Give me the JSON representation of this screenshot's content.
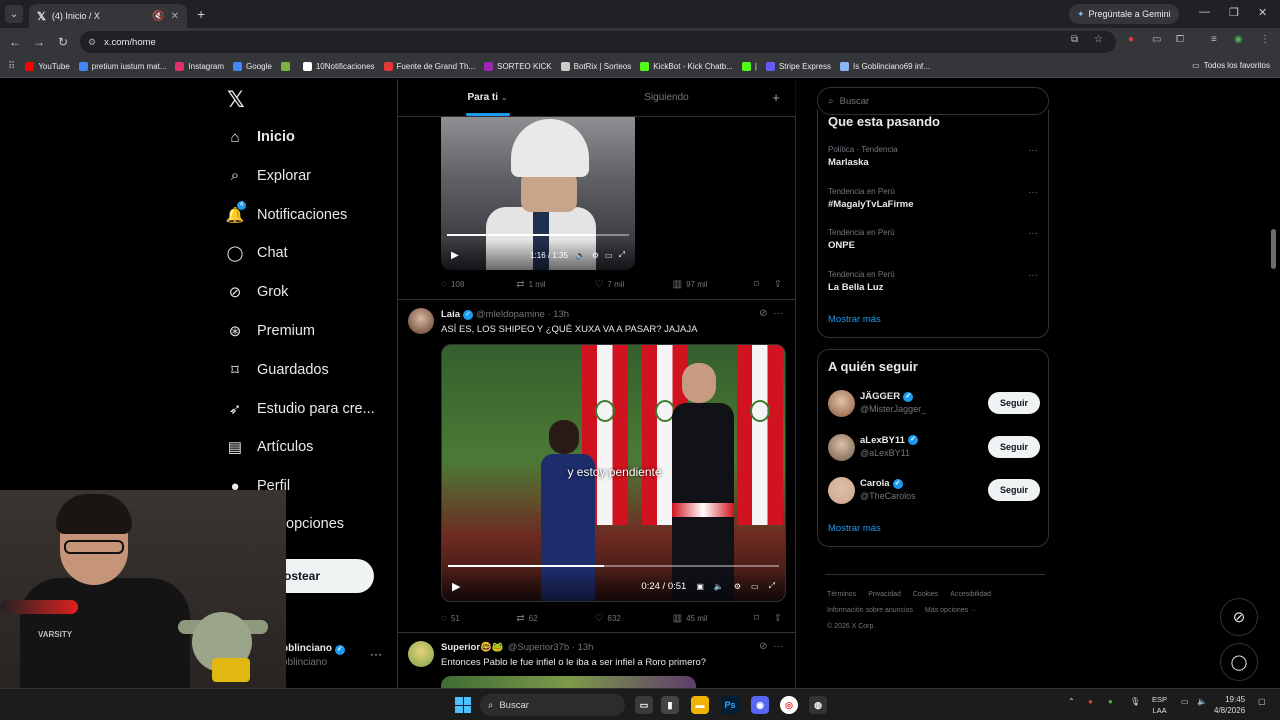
{
  "browser": {
    "tab_title": "(4) Inicio / X",
    "url": "x.com/home",
    "gemini_label": "Pregúntale a Gemini",
    "bookmarks": [
      {
        "label": "YouTube",
        "color": "#ff0000"
      },
      {
        "label": "pretium iustum mat...",
        "color": "#4285f4"
      },
      {
        "label": "Instagram",
        "color": "#e1306c"
      },
      {
        "label": "Google",
        "color": "#4285f4"
      },
      {
        "label": "",
        "color": "#7cb342"
      },
      {
        "label": "10Notificaciones",
        "color": "#ffffff"
      },
      {
        "label": "Fuente de Grand Th...",
        "color": "#e53935"
      },
      {
        "label": "SORTEO KICK",
        "color": "#9c27b0"
      },
      {
        "label": "BotRix | Sorteos",
        "color": "#cccccc"
      },
      {
        "label": "KickBot - Kick Chatb...",
        "color": "#53fc18"
      },
      {
        "label": "|",
        "color": "#53fc18"
      },
      {
        "label": "Stripe Express",
        "color": "#635bff"
      },
      {
        "label": "Is Goblinciano69 inf...",
        "color": "#8ab4f8"
      }
    ],
    "all_bookmarks": "Todos los favoritos"
  },
  "sidebar": {
    "items": [
      {
        "label": "Inicio",
        "icon": "home-icon"
      },
      {
        "label": "Explorar",
        "icon": "search-icon"
      },
      {
        "label": "Notificaciones",
        "icon": "bell-icon",
        "badge": "4"
      },
      {
        "label": "Chat",
        "icon": "chat-icon"
      },
      {
        "label": "Grok",
        "icon": "grok-icon"
      },
      {
        "label": "Premium",
        "icon": "premium-icon"
      },
      {
        "label": "Guardados",
        "icon": "bookmark-icon"
      },
      {
        "label": "Estudio para cre...",
        "icon": "rocket-icon"
      },
      {
        "label": "Artículos",
        "icon": "article-icon"
      },
      {
        "label": "Perfil",
        "icon": "person-icon"
      },
      {
        "label": "opciones",
        "icon": "more-icon"
      }
    ],
    "post_button": "ostear",
    "profile_name": "oblinciano",
    "profile_handle": "oblinciano"
  },
  "feed": {
    "tabs": [
      "Para ti",
      "Siguiendo"
    ],
    "tweet1": {
      "time": "1:16 / 1:35",
      "progress": 0.82,
      "replies": "108",
      "reposts": "1 mil",
      "likes": "7 mil",
      "views": "97 mil"
    },
    "tweet2": {
      "name": "Laia",
      "handle": "@mleldopamine · 13h",
      "text": "ASÍ ES, LOS SHIPEO Y ¿QUÉ XUXA VA A PASAR? JAJAJA",
      "subtitle": "y estoy pendiente",
      "time": "0:24 / 0:51",
      "progress": 0.47,
      "replies": "51",
      "reposts": "62",
      "likes": "632",
      "views": "45 mil"
    },
    "tweet3": {
      "name": "Superior🤓🐸",
      "handle": "@Superior37b · 13h",
      "text": "Entonces Pablo le fue infiel o le iba a ser infiel a Roro primero?"
    }
  },
  "right": {
    "search_placeholder": "Buscar",
    "trends_title": "Que esta pasando",
    "trends": [
      {
        "context": "Política · Tendencia",
        "name": "Marlaska"
      },
      {
        "context": "Tendencia en Perú",
        "name": "#MagalyTvLaFirme"
      },
      {
        "context": "Tendencia en Perú",
        "name": "ONPE"
      },
      {
        "context": "Tendencia en Perú",
        "name": "La Bella Luz"
      }
    ],
    "show_more": "Mostrar más",
    "follow_title": "A quién seguir",
    "follow": [
      {
        "name": "JÄGGER",
        "handle": "@MisterJagger_",
        "button": "Seguir",
        "color": "#8a5a3c"
      },
      {
        "name": "aLexBY11",
        "handle": "@aLexBY11",
        "button": "Seguir",
        "color": "#6b5a48"
      },
      {
        "name": "Carola",
        "handle": "@TheCarolos",
        "button": "Seguir",
        "color": "#c9a58c"
      }
    ],
    "footer": [
      "Términos",
      "Privacidad",
      "Cookies",
      "Accesibilidad",
      "Información sobre anuncios",
      "Más opciones ···",
      "© 2026 X Corp."
    ]
  },
  "webcam": {
    "shirt_text": "VARSITY"
  },
  "taskbar": {
    "search": "Buscar",
    "lang_top": "ESP",
    "lang_bottom": "LAA",
    "time": "19:45",
    "date": "4/8/2026"
  }
}
